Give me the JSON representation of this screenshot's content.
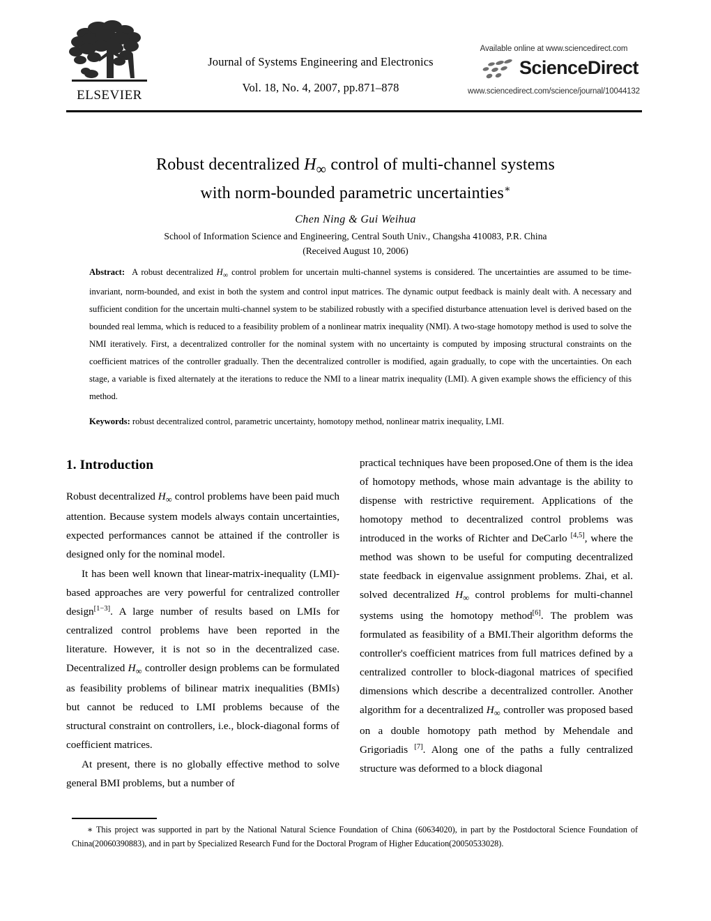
{
  "masthead": {
    "publisher_logo_name": "elsevier-tree-logo",
    "publisher_word": "ELSEVIER",
    "journal_title": "Journal of Systems Engineering and Electronics",
    "journal_volume_line": "Vol. 18, No. 4, 2007, pp.871–878",
    "sciencedirect": {
      "available_line": "Available online at www.sciencedirect.com",
      "brand": "ScienceDirect",
      "url": "www.sciencedirect.com/science/journal/10044132"
    }
  },
  "title": {
    "line1_before": "Robust decentralized ",
    "line1_math_h": "H",
    "line1_math_sub": "∞",
    "line1_after": " control of multi-channel systems",
    "line2": "with norm-bounded parametric uncertainties",
    "line2_footnote_marker": "∗"
  },
  "authors": "Chen Ning & Gui Weihua",
  "affiliation": "School of Information Science and Engineering, Central South Univ., Changsha 410083, P.R. China",
  "received": "(Received August 10, 2006)",
  "abstract": {
    "label": "Abstract:",
    "text_part1": "A robust decentralized ",
    "math_h": "H",
    "math_sub": "∞",
    "text_part2": " control problem for uncertain multi-channel systems is considered. The uncertainties are assumed to be time-invariant, norm-bounded, and exist in both the system and control input matrices. The dynamic output feedback is mainly dealt with. A necessary and sufficient condition for the uncertain multi-channel system to be stabilized robustly with a specified disturbance attenuation level is derived based on the bounded real lemma, which is reduced to a feasibility problem of a nonlinear matrix inequality (NMI). A two-stage homotopy method is used to solve the NMI iteratively. First, a decentralized controller for the nominal system with no uncertainty is computed by imposing structural constraints on the coefficient matrices of the controller gradually. Then the decentralized controller is modified, again gradually, to cope with the uncertainties. On each stage, a variable is fixed alternately at the iterations to reduce the NMI to a linear matrix inequality (LMI). A given example shows the efficiency of this method."
  },
  "keywords": {
    "label": "Keywords:",
    "text": "robust decentralized control, parametric uncertainty, homotopy method, nonlinear matrix inequality, LMI."
  },
  "body": {
    "section1_heading": "1. Introduction",
    "left_column": {
      "p1_before": "Robust decentralized ",
      "p1_math_h": "H",
      "p1_math_sub": "∞",
      "p1_after": " control problems have been paid much attention. Because system models always contain uncertainties, expected performances cannot be attained if the controller is designed only for the nominal model.",
      "p2_a": "It has been well known that linear-matrix-inequality (LMI)-based approaches are very powerful for centralized controller design",
      "p2_ref1": "[1−3]",
      "p2_b": ". A large number of results based on LMIs for centralized control problems have been reported in the literature. However, it is not so in the decentralized case. Decentralized ",
      "p2_math_h": "H",
      "p2_math_sub": "∞",
      "p2_c": " controller design problems can be formulated as feasibility problems of bilinear matrix inequalities (BMIs) but cannot be reduced to LMI problems because of the structural constraint on controllers, i.e., block-diagonal forms of coefficient matrices.",
      "p3": "At present, there is no globally effective method to solve general BMI problems, but a number of"
    },
    "right_column": {
      "p1_a": "practical techniques have been proposed.One of them is the idea of homotopy methods, whose main advantage is the ability to dispense with restrictive requirement. Applications of the homotopy method to decentralized control problems was introduced in the works of Richter and DeCarlo ",
      "p1_ref1": "[4,5]",
      "p1_b": ", where the method was shown to be useful for computing decentralized state feedback in eigenvalue assignment problems. Zhai, et al. solved decentralized ",
      "p1_math_h": "H",
      "p1_math_sub": "∞",
      "p1_c": " control problems for multi-channel systems using the homotopy method",
      "p1_ref2": "[6]",
      "p1_d": ". The problem was formulated as feasibility of a BMI.Their algorithm deforms the controller's coefficient matrices from full matrices defined by a centralized controller to block-diagonal matrices of specified dimensions which describe a decentralized controller. Another algorithm for a decentralized ",
      "p1_math_h2": "H",
      "p1_math_sub2": "∞",
      "p1_e": " controller was proposed based on a double homotopy path method by Mehendale and Grigoriadis ",
      "p1_ref3": "[7]",
      "p1_f": ". Along one of the paths a fully centralized structure was deformed to a block diagonal"
    }
  },
  "footnote": {
    "marker": "∗",
    "text": " This project was supported in part by the National Natural Science Foundation of China (60634020), in part by the Postdoctoral Science Foundation of China(20060390883), and in part by Specialized Research Fund for the Doctoral Program of Higher Education(20050533028)."
  },
  "colors": {
    "text": "#000000",
    "rule": "#000000",
    "sciencedirect_gray": "#2e2e2e"
  }
}
